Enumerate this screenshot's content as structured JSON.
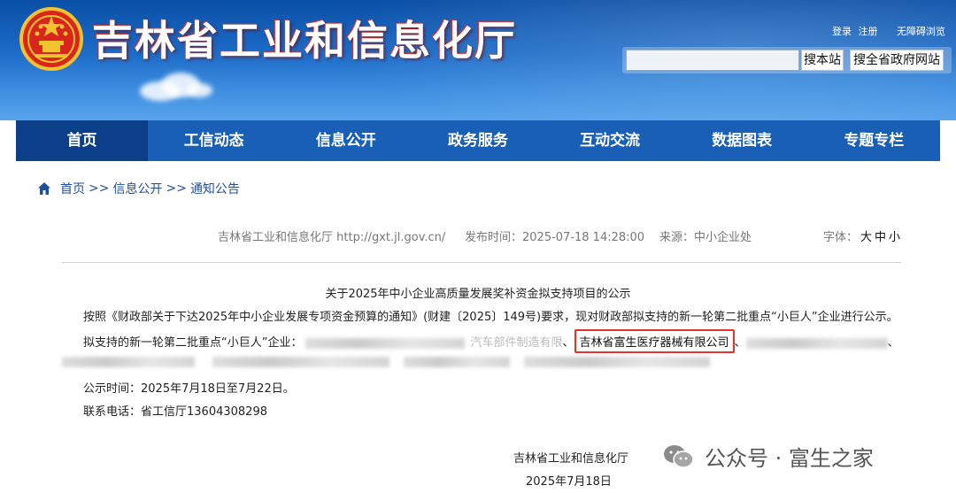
{
  "header": {
    "site_title": "吉林省工业和信息化厅",
    "links": [
      "登录",
      "注册",
      "无障碍浏览"
    ],
    "search_placeholder": "",
    "search_site_label": "搜本站",
    "search_gov_label": "搜全省政府网站",
    "colors": {
      "header_top": "#0a4fa6",
      "header_bottom": "#5aa4ec",
      "title_shadow": "#d43a2f"
    }
  },
  "nav": {
    "items": [
      "首页",
      "工信动态",
      "信息公开",
      "政务服务",
      "互动交流",
      "数据图表",
      "专题专栏"
    ],
    "active_index": 0,
    "colors": {
      "bg": "#1a5fb6",
      "active": "#0c3f8a"
    }
  },
  "breadcrumb": {
    "icon": "home-icon",
    "items": [
      "首页",
      "信息公开",
      "通知公告"
    ],
    "separator": ">>"
  },
  "meta": {
    "source_site": "吉林省工业和信息化厅 http://gxt.jl.gov.cn/",
    "published": "发布时间：2025-07-18 14:28:00",
    "source": "来源：中小企业处",
    "font_label": "字体：",
    "font_sizes": [
      "大",
      "中",
      "小"
    ]
  },
  "article": {
    "title": "关于2025年中小企业高质量发展奖补资金拟支持项目的公示",
    "para1": "按照《财政部关于下达2025年中小企业发展专项资金预算的通知》(财建〔2025〕149号)要求，现对财政部拟支持的新一轮第二批重点“小巨人”企业进行公示。",
    "para2_prefix": "拟支持的新一轮第二批重点“小巨人”企业：",
    "para2_partial": "汽车部件制造有限",
    "para2_sep1": "、",
    "para2_highlight": "吉林省富生医疗器械有限公司",
    "para2_sep2": "、",
    "para2_tail": "、",
    "period": "公示时间：2025年7月18日至7月22日。",
    "phone": "联系电话：省工信厅13604308298",
    "signature_org": "吉林省工业和信息化厅",
    "signature_date": "2025年7月18日",
    "highlight_color": "#e0352b"
  },
  "watermark": {
    "icon": "wechat-icon",
    "text": "公众号 · 富生之家"
  }
}
